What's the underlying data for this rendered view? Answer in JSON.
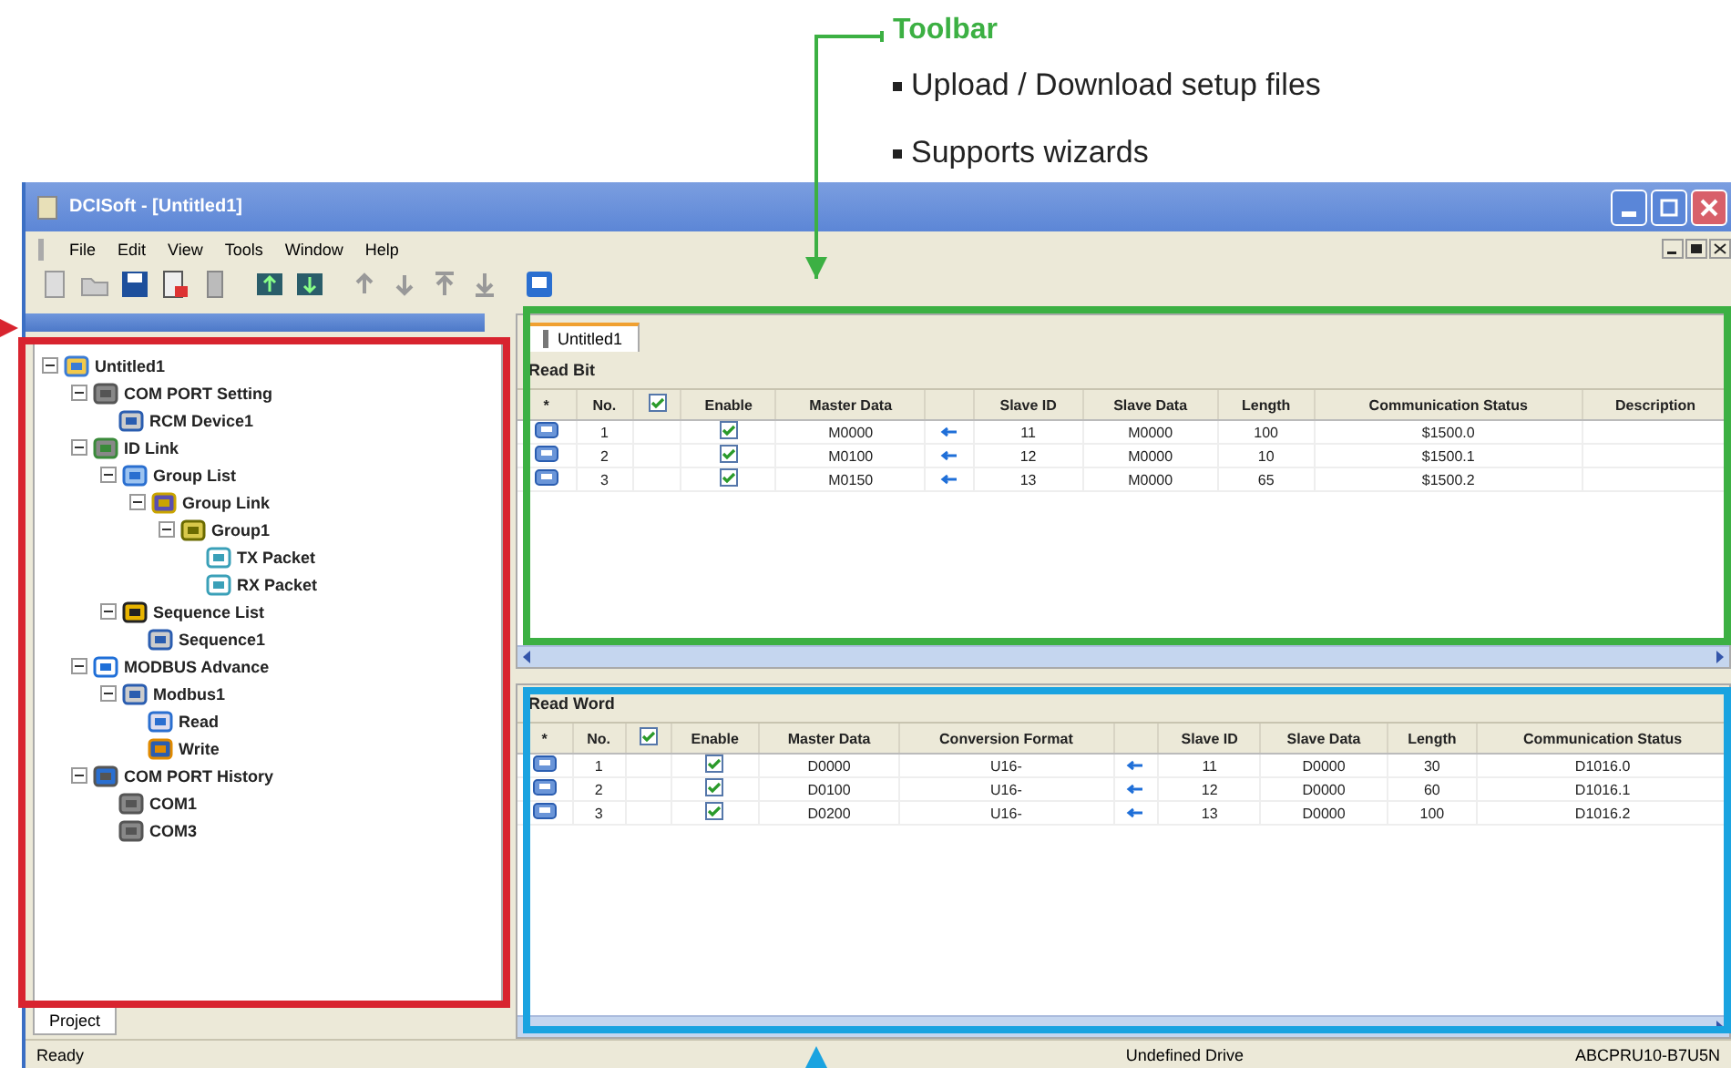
{
  "callout": {
    "title": "Toolbar",
    "bullets": [
      "Upload / Download setup files",
      "Supports wizards"
    ]
  },
  "window": {
    "title": "DCISoft - [Untitled1]"
  },
  "menu": [
    "File",
    "Edit",
    "View",
    "Tools",
    "Window",
    "Help"
  ],
  "tree": [
    {
      "label": "Untitled1",
      "kind": "project",
      "expanded": true,
      "children": [
        {
          "label": "COM PORT Setting",
          "kind": "port",
          "expanded": true,
          "children": [
            {
              "label": "RCM Device1",
              "kind": "device"
            }
          ]
        },
        {
          "label": "ID Link",
          "kind": "link",
          "expanded": true,
          "children": [
            {
              "label": "Group List",
              "kind": "list",
              "expanded": true,
              "children": [
                {
                  "label": "Group Link",
                  "kind": "group",
                  "expanded": true,
                  "children": [
                    {
                      "label": "Group1",
                      "kind": "folder",
                      "expanded": true,
                      "children": [
                        {
                          "label": "TX Packet",
                          "kind": "packet"
                        },
                        {
                          "label": "RX Packet",
                          "kind": "packet"
                        }
                      ]
                    }
                  ]
                }
              ]
            },
            {
              "label": "Sequence List",
              "kind": "sequence",
              "expanded": true,
              "children": [
                {
                  "label": "Sequence1",
                  "kind": "device"
                }
              ]
            }
          ]
        },
        {
          "label": "MODBUS Advance",
          "kind": "modbus",
          "expanded": true,
          "children": [
            {
              "label": "Modbus1",
              "kind": "device",
              "expanded": true,
              "children": [
                {
                  "label": "Read",
                  "kind": "read"
                },
                {
                  "label": "Write",
                  "kind": "write"
                }
              ]
            }
          ]
        },
        {
          "label": "COM PORT History",
          "kind": "history",
          "expanded": true,
          "children": [
            {
              "label": "COM1",
              "kind": "port"
            },
            {
              "label": "COM3",
              "kind": "port"
            }
          ]
        }
      ]
    }
  ],
  "project_tab": "Project",
  "doc_tab": "Untitled1",
  "grids": [
    {
      "title": "Read Bit",
      "all_enabled": true,
      "columns": [
        "*",
        "No.",
        "",
        "Enable",
        "Master Data",
        "",
        "Slave ID",
        "Slave Data",
        "Length",
        "Communication Status",
        "Description"
      ],
      "rows": [
        {
          "enable": true,
          "cells": [
            "",
            "1",
            "",
            "",
            "M0000",
            "",
            "11",
            "M0000",
            "100",
            "$1500.0",
            ""
          ]
        },
        {
          "enable": true,
          "cells": [
            "",
            "2",
            "",
            "",
            "M0100",
            "",
            "12",
            "M0000",
            "10",
            "$1500.1",
            ""
          ]
        },
        {
          "enable": true,
          "cells": [
            "",
            "3",
            "",
            "",
            "M0150",
            "",
            "13",
            "M0000",
            "65",
            "$1500.2",
            ""
          ]
        }
      ]
    },
    {
      "title": "Read Word",
      "all_enabled": true,
      "columns": [
        "*",
        "No.",
        "",
        "Enable",
        "Master Data",
        "Conversion Format",
        "",
        "Slave ID",
        "Slave Data",
        "Length",
        "Communication Status"
      ],
      "rows": [
        {
          "enable": true,
          "cells": [
            "",
            "1",
            "",
            "",
            "D0000",
            "U16-",
            "",
            "11",
            "D0000",
            "30",
            "D1016.0"
          ]
        },
        {
          "enable": true,
          "cells": [
            "",
            "2",
            "",
            "",
            "D0100",
            "U16-",
            "",
            "12",
            "D0000",
            "60",
            "D1016.1"
          ]
        },
        {
          "enable": true,
          "cells": [
            "",
            "3",
            "",
            "",
            "D0200",
            "U16-",
            "",
            "13",
            "D0000",
            "100",
            "D1016.2"
          ]
        }
      ]
    }
  ],
  "status_bar": [
    "Ready",
    "Undefined Drive",
    "ABCPRU10-B7U5N"
  ]
}
